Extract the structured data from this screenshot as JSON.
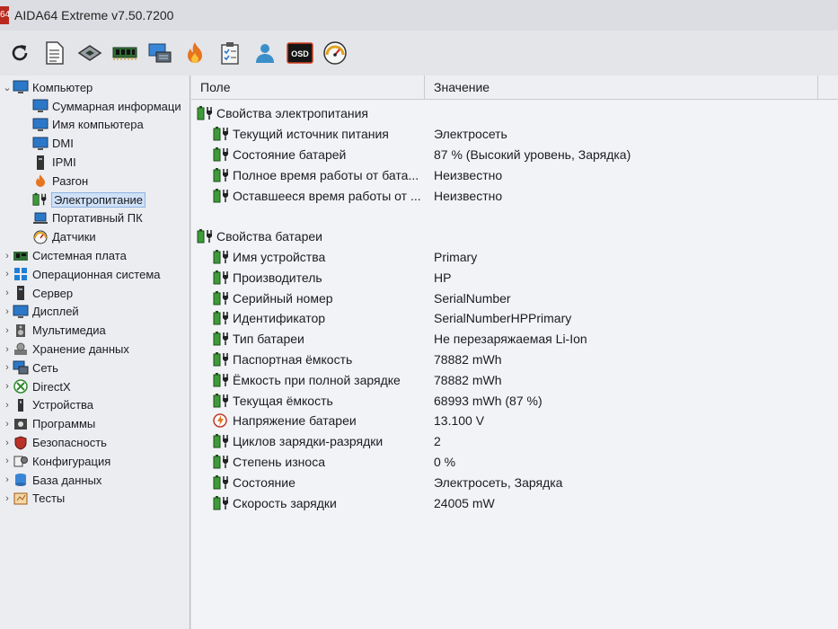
{
  "window": {
    "title": "AIDA64 Extreme v7.50.7200",
    "badge": "64"
  },
  "toolbar": {
    "buttons": [
      {
        "name": "refresh-button",
        "icon": "refresh-icon"
      },
      {
        "name": "report-button",
        "icon": "document-icon"
      },
      {
        "name": "cpu-button",
        "icon": "chip-icon"
      },
      {
        "name": "memory-button",
        "icon": "memory-module-icon"
      },
      {
        "name": "network-button",
        "icon": "network-icon"
      },
      {
        "name": "stability-test-button",
        "icon": "flame-icon"
      },
      {
        "name": "benchmark-button",
        "icon": "checklist-icon"
      },
      {
        "name": "users-button",
        "icon": "user-icon"
      },
      {
        "name": "osd-button",
        "icon": "osd-icon",
        "label": "OSD"
      },
      {
        "name": "sensors-button",
        "icon": "gauge-icon"
      }
    ]
  },
  "tree": {
    "root": "Компьютер",
    "children": [
      "Суммарная информаци",
      "Имя компьютера",
      "DMI",
      "IPMI",
      "Разгон",
      "Электропитание",
      "Портативный ПК",
      "Датчики"
    ],
    "selected": "Электропитание",
    "categories": [
      "Системная плата",
      "Операционная система",
      "Сервер",
      "Дисплей",
      "Мультимедиа",
      "Хранение данных",
      "Сеть",
      "DirectX",
      "Устройства",
      "Программы",
      "Безопасность",
      "Конфигурация",
      "База данных",
      "Тесты"
    ]
  },
  "columns": {
    "field": "Поле",
    "value": "Значение"
  },
  "groups": [
    {
      "title": "Свойства электропитания",
      "rows": [
        {
          "field": "Текущий источник питания",
          "value": "Электросеть"
        },
        {
          "field": "Состояние батарей",
          "value": "87 % (Высокий уровень, Зарядка)"
        },
        {
          "field": "Полное время работы от бата...",
          "value": "Неизвестно"
        },
        {
          "field": "Оставшееся время работы от ...",
          "value": "Неизвестно"
        }
      ]
    },
    {
      "title": "Свойства батареи",
      "rows": [
        {
          "field": "Имя устройства",
          "value": "Primary"
        },
        {
          "field": "Производитель",
          "value": "HP"
        },
        {
          "field": "Серийный номер",
          "value": "SerialNumber"
        },
        {
          "field": "Идентификатор",
          "value": "SerialNumberHPPrimary"
        },
        {
          "field": "Тип батареи",
          "value": "Не перезаряжаемая Li-Ion"
        },
        {
          "field": "Паспортная ёмкость",
          "value": "78882 mWh"
        },
        {
          "field": "Ёмкость при полной зарядке",
          "value": "78882 mWh"
        },
        {
          "field": "Текущая ёмкость",
          "value": "68993 mWh  (87 %)"
        },
        {
          "field": "Напряжение батареи",
          "value": "13.100 V",
          "icon": "voltage-icon"
        },
        {
          "field": "Циклов зарядки-разрядки",
          "value": "2"
        },
        {
          "field": "Степень износа",
          "value": "0 %"
        },
        {
          "field": "Состояние",
          "value": "Электросеть, Зарядка"
        },
        {
          "field": "Скорость зарядки",
          "value": "24005 mW"
        }
      ]
    }
  ],
  "colors": {
    "battery_green": "#3f9b3a",
    "selection": "#cfe1f7",
    "accent_red": "#b82a1e"
  }
}
